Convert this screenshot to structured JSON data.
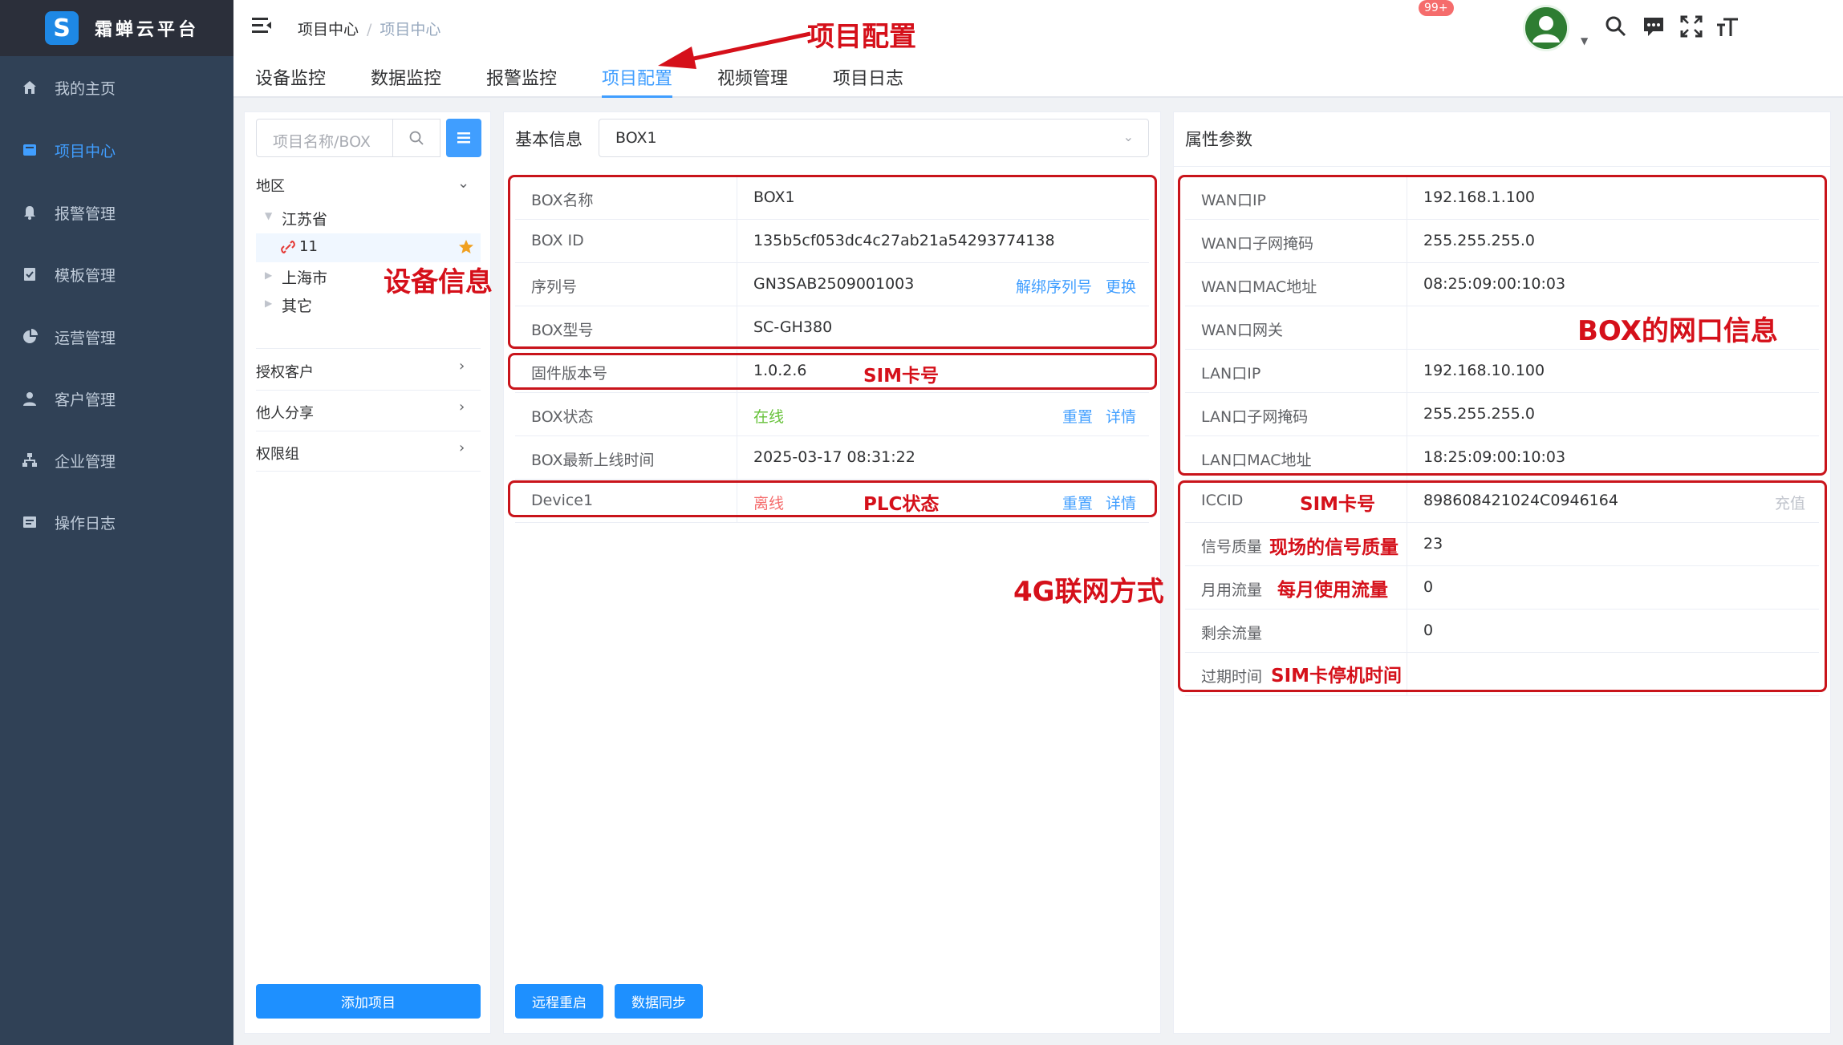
{
  "app": {
    "logo_letter": "S",
    "title": "霜蝉云平台"
  },
  "sidebar": {
    "items": [
      {
        "label": "我的主页",
        "icon": "home-icon"
      },
      {
        "label": "项目中心",
        "icon": "project-icon",
        "active": true
      },
      {
        "label": "报警管理",
        "icon": "bell-icon"
      },
      {
        "label": "模板管理",
        "icon": "template-icon"
      },
      {
        "label": "运营管理",
        "icon": "pie-chart-icon"
      },
      {
        "label": "客户管理",
        "icon": "user-icon"
      },
      {
        "label": "企业管理",
        "icon": "org-icon"
      },
      {
        "label": "操作日志",
        "icon": "log-icon"
      }
    ]
  },
  "header": {
    "breadcrumb": [
      "项目中心",
      "项目中心"
    ],
    "badge": "99+"
  },
  "tabs": [
    "设备监控",
    "数据监控",
    "报警监控",
    "项目配置",
    "视频管理",
    "项目日志"
  ],
  "left_panel": {
    "search_placeholder": "项目名称/BOX",
    "region_label": "地区",
    "tree": [
      "江苏省",
      "11",
      "上海市",
      "其它"
    ],
    "sections": [
      "授权客户",
      "他人分享",
      "权限组"
    ],
    "add_button": "添加项目"
  },
  "basic_info": {
    "title": "基本信息",
    "selected_box": "BOX1",
    "rows": [
      {
        "label": "BOX名称",
        "value": "BOX1"
      },
      {
        "label": "BOX ID",
        "value": "135b5cf053dc4c27ab21a54293774138"
      },
      {
        "label": "序列号",
        "value": "GN3SAB2509001003",
        "link1": "解绑序列号",
        "link2": "更换"
      },
      {
        "label": "BOX型号",
        "value": "SC-GH380"
      },
      {
        "label": "固件版本号",
        "value": "1.0.2.6"
      },
      {
        "label": "BOX状态",
        "value": "在线",
        "link1": "重置",
        "link2": "详情"
      },
      {
        "label": "BOX最新上线时间",
        "value": "2025-03-17 08:31:22"
      },
      {
        "label": "Device1",
        "value": "离线",
        "link1": "重置",
        "link2": "详情"
      }
    ],
    "btn_reboot": "远程重启",
    "btn_sync": "数据同步"
  },
  "attributes": {
    "title": "属性参数",
    "rows": [
      {
        "label": "WAN口IP",
        "value": "192.168.1.100"
      },
      {
        "label": "WAN口子网掩码",
        "value": "255.255.255.0"
      },
      {
        "label": "WAN口MAC地址",
        "value": "08:25:09:00:10:03"
      },
      {
        "label": "WAN口网关",
        "value": ""
      },
      {
        "label": "LAN口IP",
        "value": "192.168.10.100"
      },
      {
        "label": "LAN口子网掩码",
        "value": "255.255.255.0"
      },
      {
        "label": "LAN口MAC地址",
        "value": "18:25:09:00:10:03"
      },
      {
        "label": "ICCID",
        "value": "898608421024C0946164",
        "link": "充值"
      },
      {
        "label": "信号质量",
        "value": "23"
      },
      {
        "label": "月用流量",
        "value": "0"
      },
      {
        "label": "剩余流量",
        "value": "0"
      },
      {
        "label": "过期时间",
        "value": ""
      }
    ]
  },
  "annotations": {
    "project_config": "项目配置",
    "device_info": "设备信息",
    "sim_card_1": "SIM卡号",
    "plc_status": "PLC状态",
    "box_network": "BOX的网口信息",
    "sim_card_2": "SIM卡号",
    "signal_quality": "现场的信号质量",
    "monthly_traffic": "每月使用流量",
    "sim_expiry": "SIM卡停机时间",
    "network_4g": "4G联网方式"
  },
  "colors": {
    "accent": "#409eff",
    "annotation": "#d5101a",
    "sidebar": "#304156"
  }
}
